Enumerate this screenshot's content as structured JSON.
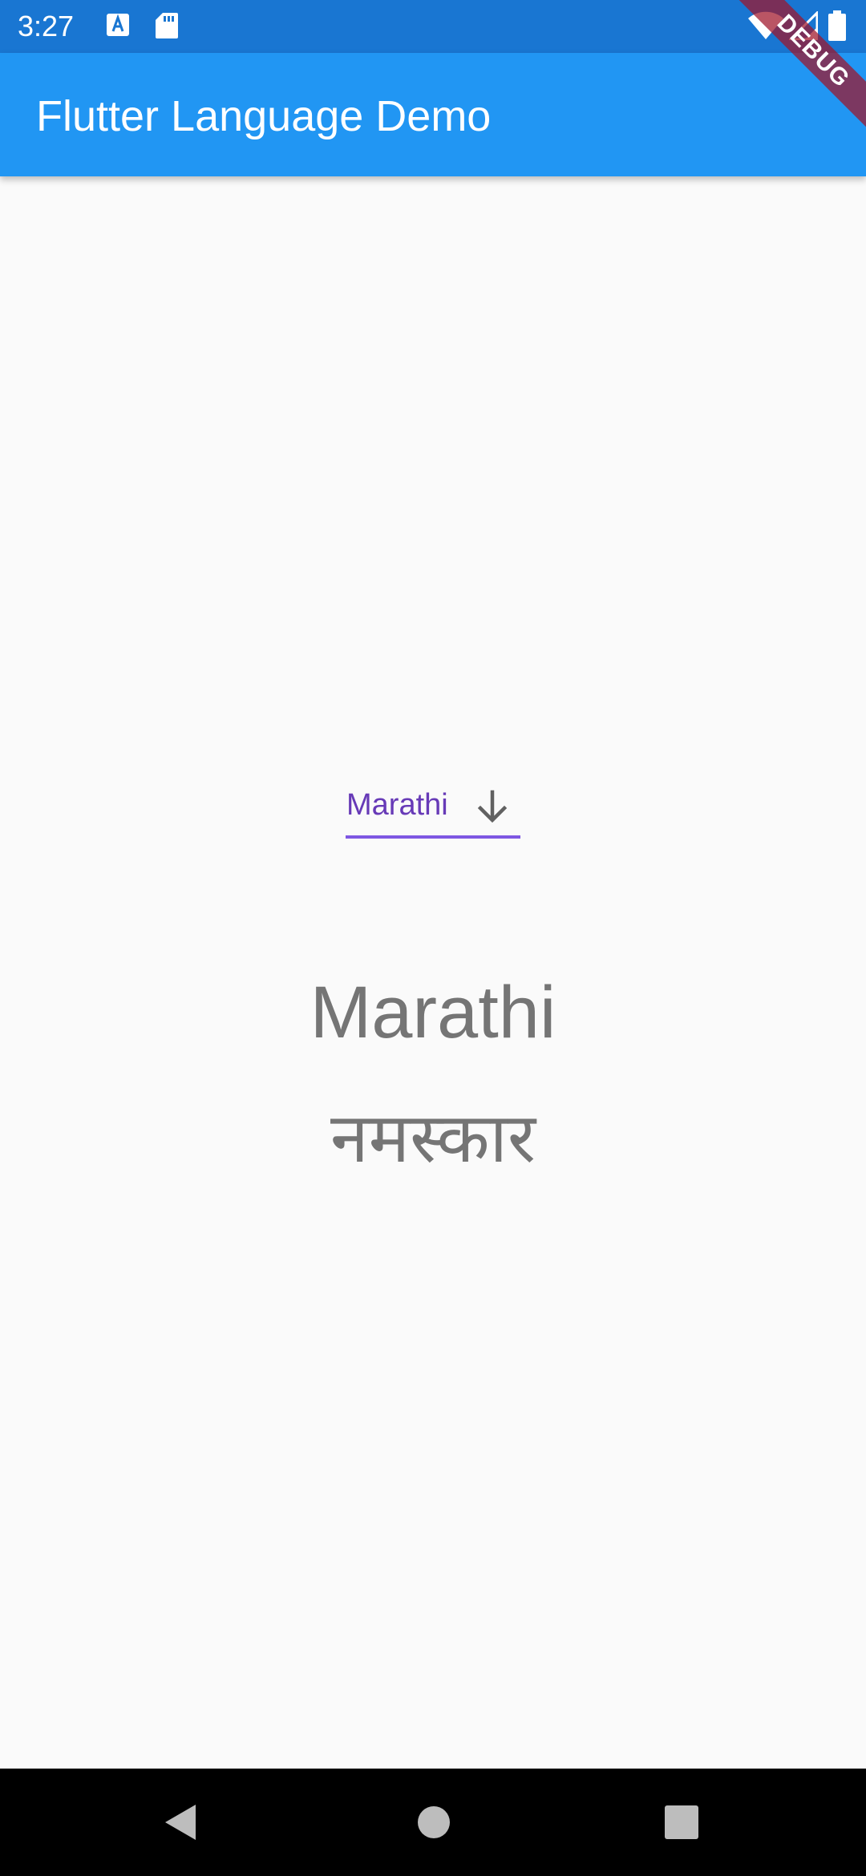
{
  "status_bar": {
    "time": "3:27",
    "icons": [
      "font-notification-icon",
      "sd-card-icon",
      "wifi-icon",
      "cell-signal-icon",
      "battery-icon"
    ]
  },
  "app_bar": {
    "title": "Flutter Language Demo"
  },
  "debug_banner": {
    "label": "DEBUG"
  },
  "language_dropdown": {
    "selected": "Marathi",
    "icon": "arrow-downward-icon"
  },
  "content": {
    "language_name": "Marathi",
    "greeting": "नमस्कार"
  },
  "nav_bar": {
    "buttons": [
      "back-icon",
      "home-icon",
      "recents-icon"
    ]
  },
  "colors": {
    "status_bar": "#1976d2",
    "app_bar": "#2196f3",
    "dropdown_text": "#673ab7",
    "dropdown_underline": "#7e57e2",
    "body_text": "#757575",
    "background": "#fafafa"
  }
}
